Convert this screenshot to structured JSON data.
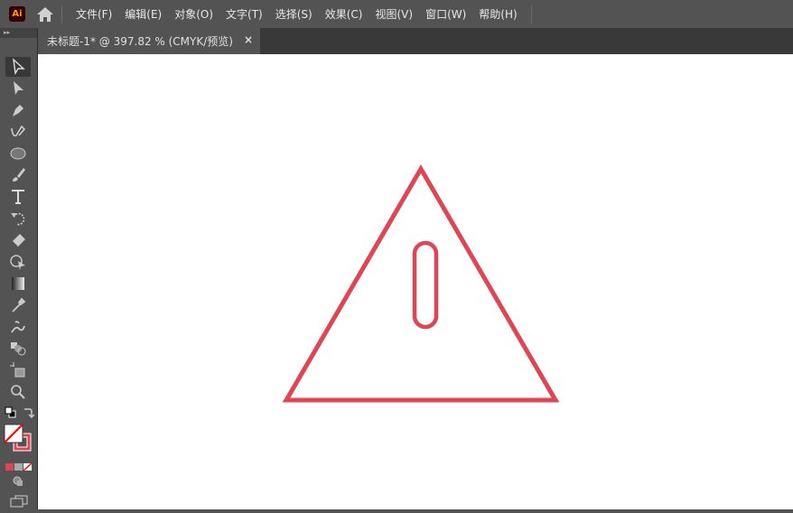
{
  "app": {
    "logo": "Ai",
    "accent": "#ff9a00"
  },
  "menu": [
    "文件(F)",
    "编辑(E)",
    "对象(O)",
    "文字(T)",
    "选择(S)",
    "效果(C)",
    "视图(V)",
    "窗口(W)",
    "帮助(H)"
  ],
  "document_tab": {
    "title": "未标题-1* @ 397.82 % (CMYK/预览)",
    "close": "×"
  },
  "toolbar": {
    "collapse": "▸▸",
    "tools": [
      "selection",
      "direct-selection",
      "pen",
      "curvature",
      "ellipse",
      "paintbrush",
      "type",
      "rotate",
      "eraser",
      "shape-builder",
      "gradient",
      "eyedropper",
      "puppet-warp",
      "blend",
      "artboard",
      "zoom"
    ]
  },
  "artwork": {
    "stroke_color": "#e04556"
  }
}
